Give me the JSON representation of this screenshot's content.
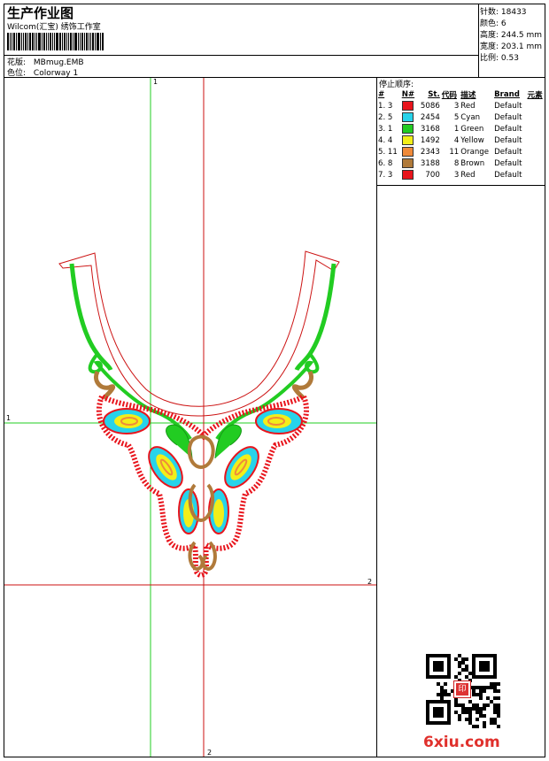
{
  "header": {
    "title": "生产作业图",
    "subtitle": "Wilcom(汇宝) 绣饰工作室",
    "design_label": "花版:",
    "design_value": "MBmug.EMB",
    "colorway_label": "色位:",
    "colorway_value": "Colorway 1"
  },
  "stats": {
    "stitches": "针数: 18433",
    "colors": "颜色: 6",
    "height": "高度: 244.5 mm",
    "width": "宽度: 203.1 mm",
    "scale": "比例: 0.53"
  },
  "stop_sequence": {
    "title": "停止顺序:",
    "headers": [
      "#",
      "N#",
      "St.",
      "代码",
      "描述",
      "Brand",
      "元素"
    ],
    "rows": [
      {
        "idx": "1. 3",
        "color": "#e8141c",
        "st": "5086",
        "code": "3",
        "desc": "Red",
        "brand": "Default"
      },
      {
        "idx": "2. 5",
        "color": "#27d3ea",
        "st": "2454",
        "code": "5",
        "desc": "Cyan",
        "brand": "Default"
      },
      {
        "idx": "3. 1",
        "color": "#22cc22",
        "st": "3168",
        "code": "1",
        "desc": "Green",
        "brand": "Default"
      },
      {
        "idx": "4. 4",
        "color": "#f2ee1a",
        "st": "1492",
        "code": "4",
        "desc": "Yellow",
        "brand": "Default"
      },
      {
        "idx": "5. 11",
        "color": "#ef8a3a",
        "st": "2343",
        "code": "11",
        "desc": "Orange",
        "brand": "Default"
      },
      {
        "idx": "6. 8",
        "color": "#b07a3a",
        "st": "3188",
        "code": "8",
        "desc": "Brown",
        "brand": "Default"
      },
      {
        "idx": "7. 3",
        "color": "#e8141c",
        "st": "700",
        "code": "3",
        "desc": "Red",
        "brand": "Default"
      }
    ]
  },
  "axes": {
    "v1_top": "1",
    "h1_left": "1",
    "h2_right": "2",
    "v2_bottom": "2"
  },
  "footer": {
    "site": "6xiu.com",
    "seal_text": "印"
  },
  "colors": {
    "crosshair": "#22cc22",
    "guide": "#cc1111",
    "red": "#e8141c",
    "cyan": "#27d3ea",
    "green": "#22cc22",
    "yellow": "#f2ee1a",
    "orange": "#ef8a3a",
    "brown": "#b07a3a"
  }
}
